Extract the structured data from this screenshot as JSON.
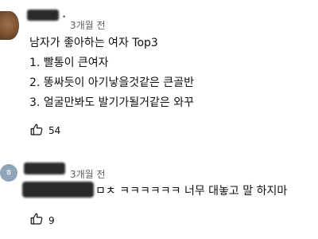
{
  "comment1": {
    "time": "3개월 전",
    "lines": [
      "남자가 좋아하는 여자 Top3",
      "1. 빨통이 큰여자",
      "2. 똥싸듯이 아기낳을것같은 큰골반",
      "3. 얼굴만봐도 발기가될거같은 와꾸"
    ],
    "likes": "54"
  },
  "comment2": {
    "avatar_letter": "ㅎ",
    "time": "3개월 전",
    "text": "ㅁㅊ ㅋㅋㅋㅋㅋㅋ 너무 대놓고 말 하지마",
    "likes": "9"
  },
  "icons": {
    "like": "thumbs-up-icon"
  }
}
